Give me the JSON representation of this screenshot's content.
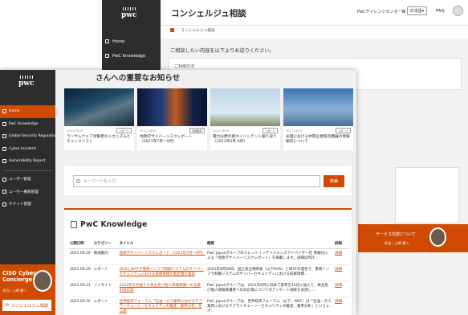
{
  "back_window": {
    "logo": "pwc",
    "sidebar": [
      {
        "label": "Home",
        "icon": "home-icon"
      },
      {
        "label": "PwC Knowledge",
        "icon": "book-icon"
      }
    ],
    "title": "コンシェルジュ相談",
    "user": "PwCチャレンジセンター様",
    "language": "日本語",
    "faq": "FAQ",
    "breadcrumb": "コンシェルジュ相談",
    "form_question": "ご相談したい内容を以下よりお送りください。",
    "form_field_label": "ご利用方法",
    "banner_title": "サービス内容について",
    "banner_name": "担当｜土師 慶二"
  },
  "sidebar": {
    "logo": "pwc",
    "items": [
      {
        "label": "Home",
        "icon": "home-icon",
        "active": true
      },
      {
        "label": "PwC Knowledge",
        "icon": "book-icon",
        "active": false
      },
      {
        "label": "Global Security Regulation",
        "icon": "globe-icon",
        "active": false
      },
      {
        "label": "Cyber Incident",
        "icon": "alert-icon",
        "active": false
      },
      {
        "label": "Vulnerability Report",
        "icon": "report-icon",
        "active": false
      }
    ],
    "admin_items": [
      {
        "label": "ユーザー管理",
        "icon": "users-icon"
      },
      {
        "label": "ユーザー権限管理",
        "icon": "lock-icon"
      },
      {
        "label": "チケット管理",
        "icon": "ticket-icon"
      }
    ],
    "cisco": {
      "title": "CISO Cyber Concierge",
      "name": "担当｜土師 慶二",
      "button": "コンシェルジュ相談"
    }
  },
  "notice": {
    "title": "さんへの重要なお知らせ",
    "cards": [
      {
        "date": "2021.08.09",
        "tag": "レポート",
        "title": "ランサムウェア攻撃者のメカニズムとチェックリスト"
      },
      {
        "date": "2021.08.09",
        "tag": "脅威動向",
        "title": "地政学サイバーリスクレポート（2021年7月〜9月）"
      },
      {
        "date": "2021.08.09",
        "tag": "レポート",
        "title": "電力分野の重大インシデント振り返り（2021年3月-6月）"
      },
      {
        "date": "2021.08.09",
        "tag": "レポート",
        "title": "米国における仲間企業製造機器の情報動向について"
      }
    ]
  },
  "search": {
    "placeholder": "キーワードを入力",
    "button": "検索"
  },
  "knowledge": {
    "title": "PwC Knowledge",
    "columns": [
      "公開日時",
      "カテゴリー",
      "タイトル",
      "概要",
      "詳細"
    ],
    "rows": [
      {
        "date": "2021.09.29",
        "category": "脅威動向",
        "title": "地政学サイバーリスクレポート（2021年7月〜9月）",
        "summary": "PwC Japanグループのスレットインテリジェンスアドバイザー社 情報化による「地政学サイバーリスクレポート」を掲載します。詳細はPDF…",
        "detail": "詳細"
      },
      {
        "date": "2021.09.29",
        "category": "レポート",
        "title": "DHSとNISTが重要インフラ制御システムのサイバーセキュリティにおける成果目標の暫定版を発表",
        "summary": "2021年8月28日、国土安全保障省（以下DHS）とNISTの連名で、重要インフラ制御システムのサイバーセキュリティにおける成果目標…",
        "detail": "詳細"
      },
      {
        "date": "2021.09.21",
        "category": "インサイト",
        "title": "2022年を見据えた株主及び個人情報保護への企業の対応策",
        "summary": "PwC Japanグループは、2021年6月に日本で基準を15社に加えて、株主及び個人情報保護者への対応策についてのアンケート調査を実施し…",
        "detail": "詳細"
      },
      {
        "date": "2021.09.16",
        "category": "レポート",
        "title": "世界経済フォーラム「石油・ガス業界におけるサプライチェーン・セキュリティの推進：業界分析」を公表",
        "summary": "PwC Japanグループは、世界経済フォーラム（以下、WEF）は「石油・ガス業界におけるサプライチェーン・セキュリティの推進：業界分析」というレポ…",
        "detail": "詳細"
      }
    ]
  },
  "colors": {
    "accent": "#d04a02",
    "sidebar_bg": "#2d2d2d",
    "content_bg": "#f0f0f0"
  }
}
